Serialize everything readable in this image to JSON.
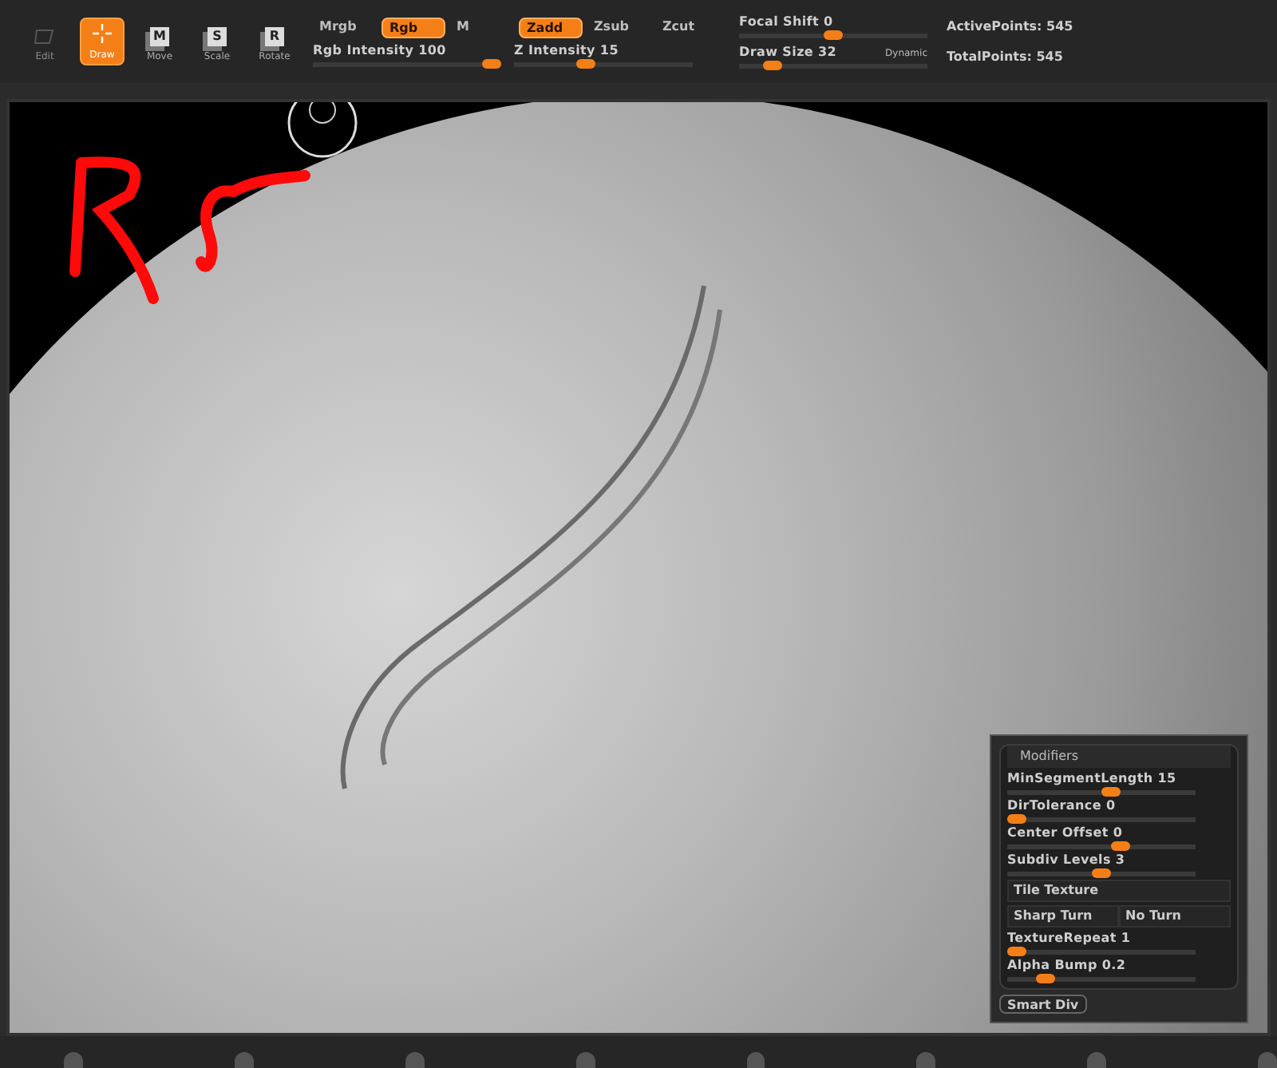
{
  "toolbar": {
    "tools": [
      {
        "label": "Edit",
        "selected": false,
        "disabled": true
      },
      {
        "label": "Draw",
        "selected": true,
        "disabled": false
      },
      {
        "label": "Move",
        "key": "M",
        "selected": false,
        "disabled": false
      },
      {
        "label": "Scale",
        "key": "S",
        "selected": false,
        "disabled": false
      },
      {
        "label": "Rotate",
        "key": "R",
        "selected": false,
        "disabled": false
      }
    ],
    "color_modes": [
      {
        "label": "Mrgb",
        "selected": false
      },
      {
        "label": "Rgb",
        "selected": true
      },
      {
        "label": "M",
        "selected": false
      }
    ],
    "z_modes": [
      {
        "label": "Zadd",
        "selected": true
      },
      {
        "label": "Zsub",
        "selected": false
      },
      {
        "label": "Zcut",
        "selected": false
      }
    ],
    "rgb_intensity": {
      "label": "Rgb Intensity 100",
      "level": 0.95
    },
    "z_intensity": {
      "label": "Z Intensity 15",
      "level": 0.4
    },
    "focal_shift": {
      "label": "Focal Shift 0",
      "level": 0.5
    },
    "draw_size": {
      "label": "Draw Size 32",
      "level": 0.18,
      "tag": "Dynamic"
    },
    "stats": [
      "ActivePoints: 545",
      "TotalPoints: 545"
    ]
  },
  "modifiers": {
    "title": "Modifiers",
    "items": [
      {
        "kind": "slider",
        "label": "MinSegmentLength 15",
        "level": 0.55
      },
      {
        "kind": "slider",
        "label": "DirTolerance 0",
        "level": 0.05
      },
      {
        "kind": "slider",
        "label": "Center Offset 0",
        "level": 0.6
      },
      {
        "kind": "slider",
        "label": "Subdiv Levels 3",
        "level": 0.5
      },
      {
        "kind": "button",
        "labels": [
          "Tile Texture"
        ]
      },
      {
        "kind": "button",
        "labels": [
          "Sharp Turn",
          "No Turn"
        ]
      },
      {
        "kind": "slider",
        "label": "TextureRepeat 1",
        "level": 0.05
      },
      {
        "kind": "slider",
        "label": "Alpha Bump 0.2",
        "level": 0.2
      }
    ]
  },
  "smart_div": "Smart Div"
}
